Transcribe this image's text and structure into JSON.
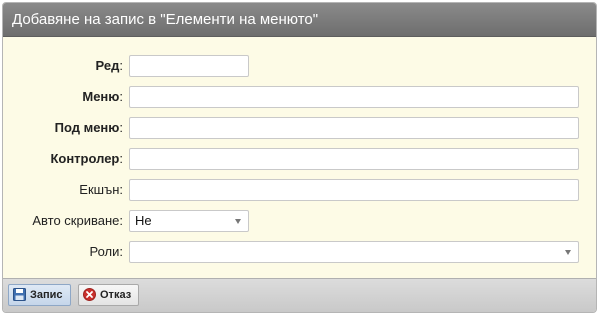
{
  "dialog": {
    "title": "Добавяне на запис в \"Елементи на менюто\""
  },
  "form": {
    "fields": [
      {
        "label": "Ред",
        "value": ""
      },
      {
        "label": "Меню",
        "value": ""
      },
      {
        "label": "Под меню",
        "value": ""
      },
      {
        "label": "Контролер",
        "value": ""
      },
      {
        "label": "Екшън",
        "value": ""
      },
      {
        "label": "Авто скриване",
        "value": "Не"
      },
      {
        "label": "Роли",
        "value": ""
      }
    ],
    "colon": ":"
  },
  "footer": {
    "save_label": "Запис",
    "cancel_label": "Отказ"
  },
  "colors": {
    "titlebar": "#7c7c7c",
    "form_background": "#fdfbe6",
    "cancel_icon": "#c9302c"
  },
  "icons": {
    "save": "floppy-disk-icon",
    "cancel": "x-circle-icon"
  }
}
